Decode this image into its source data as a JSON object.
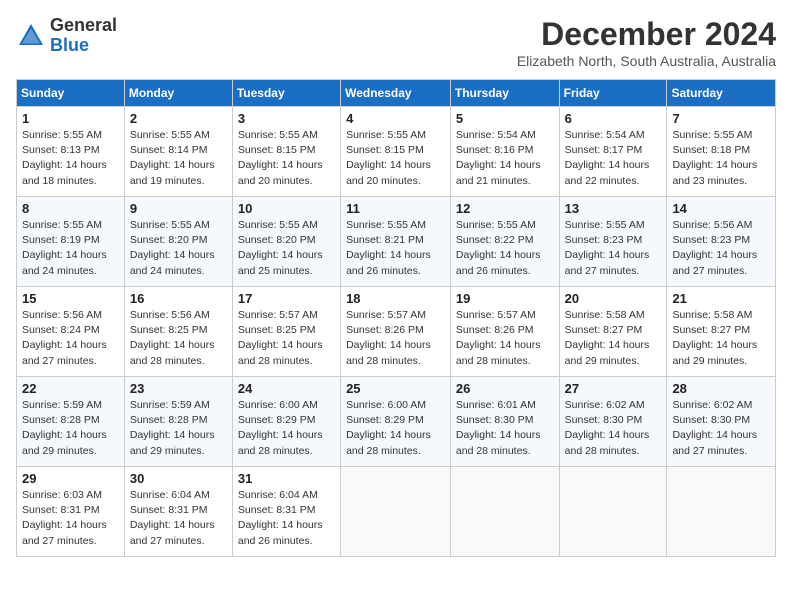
{
  "header": {
    "logo_general": "General",
    "logo_blue": "Blue",
    "month_title": "December 2024",
    "location": "Elizabeth North, South Australia, Australia"
  },
  "weekdays": [
    "Sunday",
    "Monday",
    "Tuesday",
    "Wednesday",
    "Thursday",
    "Friday",
    "Saturday"
  ],
  "weeks": [
    [
      {
        "day": "1",
        "sunrise": "5:55 AM",
        "sunset": "8:13 PM",
        "daylight": "14 hours and 18 minutes."
      },
      {
        "day": "2",
        "sunrise": "5:55 AM",
        "sunset": "8:14 PM",
        "daylight": "14 hours and 19 minutes."
      },
      {
        "day": "3",
        "sunrise": "5:55 AM",
        "sunset": "8:15 PM",
        "daylight": "14 hours and 20 minutes."
      },
      {
        "day": "4",
        "sunrise": "5:55 AM",
        "sunset": "8:15 PM",
        "daylight": "14 hours and 20 minutes."
      },
      {
        "day": "5",
        "sunrise": "5:54 AM",
        "sunset": "8:16 PM",
        "daylight": "14 hours and 21 minutes."
      },
      {
        "day": "6",
        "sunrise": "5:54 AM",
        "sunset": "8:17 PM",
        "daylight": "14 hours and 22 minutes."
      },
      {
        "day": "7",
        "sunrise": "5:55 AM",
        "sunset": "8:18 PM",
        "daylight": "14 hours and 23 minutes."
      }
    ],
    [
      {
        "day": "8",
        "sunrise": "5:55 AM",
        "sunset": "8:19 PM",
        "daylight": "14 hours and 24 minutes."
      },
      {
        "day": "9",
        "sunrise": "5:55 AM",
        "sunset": "8:20 PM",
        "daylight": "14 hours and 24 minutes."
      },
      {
        "day": "10",
        "sunrise": "5:55 AM",
        "sunset": "8:20 PM",
        "daylight": "14 hours and 25 minutes."
      },
      {
        "day": "11",
        "sunrise": "5:55 AM",
        "sunset": "8:21 PM",
        "daylight": "14 hours and 26 minutes."
      },
      {
        "day": "12",
        "sunrise": "5:55 AM",
        "sunset": "8:22 PM",
        "daylight": "14 hours and 26 minutes."
      },
      {
        "day": "13",
        "sunrise": "5:55 AM",
        "sunset": "8:23 PM",
        "daylight": "14 hours and 27 minutes."
      },
      {
        "day": "14",
        "sunrise": "5:56 AM",
        "sunset": "8:23 PM",
        "daylight": "14 hours and 27 minutes."
      }
    ],
    [
      {
        "day": "15",
        "sunrise": "5:56 AM",
        "sunset": "8:24 PM",
        "daylight": "14 hours and 27 minutes."
      },
      {
        "day": "16",
        "sunrise": "5:56 AM",
        "sunset": "8:25 PM",
        "daylight": "14 hours and 28 minutes."
      },
      {
        "day": "17",
        "sunrise": "5:57 AM",
        "sunset": "8:25 PM",
        "daylight": "14 hours and 28 minutes."
      },
      {
        "day": "18",
        "sunrise": "5:57 AM",
        "sunset": "8:26 PM",
        "daylight": "14 hours and 28 minutes."
      },
      {
        "day": "19",
        "sunrise": "5:57 AM",
        "sunset": "8:26 PM",
        "daylight": "14 hours and 28 minutes."
      },
      {
        "day": "20",
        "sunrise": "5:58 AM",
        "sunset": "8:27 PM",
        "daylight": "14 hours and 29 minutes."
      },
      {
        "day": "21",
        "sunrise": "5:58 AM",
        "sunset": "8:27 PM",
        "daylight": "14 hours and 29 minutes."
      }
    ],
    [
      {
        "day": "22",
        "sunrise": "5:59 AM",
        "sunset": "8:28 PM",
        "daylight": "14 hours and 29 minutes."
      },
      {
        "day": "23",
        "sunrise": "5:59 AM",
        "sunset": "8:28 PM",
        "daylight": "14 hours and 29 minutes."
      },
      {
        "day": "24",
        "sunrise": "6:00 AM",
        "sunset": "8:29 PM",
        "daylight": "14 hours and 28 minutes."
      },
      {
        "day": "25",
        "sunrise": "6:00 AM",
        "sunset": "8:29 PM",
        "daylight": "14 hours and 28 minutes."
      },
      {
        "day": "26",
        "sunrise": "6:01 AM",
        "sunset": "8:30 PM",
        "daylight": "14 hours and 28 minutes."
      },
      {
        "day": "27",
        "sunrise": "6:02 AM",
        "sunset": "8:30 PM",
        "daylight": "14 hours and 28 minutes."
      },
      {
        "day": "28",
        "sunrise": "6:02 AM",
        "sunset": "8:30 PM",
        "daylight": "14 hours and 27 minutes."
      }
    ],
    [
      {
        "day": "29",
        "sunrise": "6:03 AM",
        "sunset": "8:31 PM",
        "daylight": "14 hours and 27 minutes."
      },
      {
        "day": "30",
        "sunrise": "6:04 AM",
        "sunset": "8:31 PM",
        "daylight": "14 hours and 27 minutes."
      },
      {
        "day": "31",
        "sunrise": "6:04 AM",
        "sunset": "8:31 PM",
        "daylight": "14 hours and 26 minutes."
      },
      null,
      null,
      null,
      null
    ]
  ]
}
